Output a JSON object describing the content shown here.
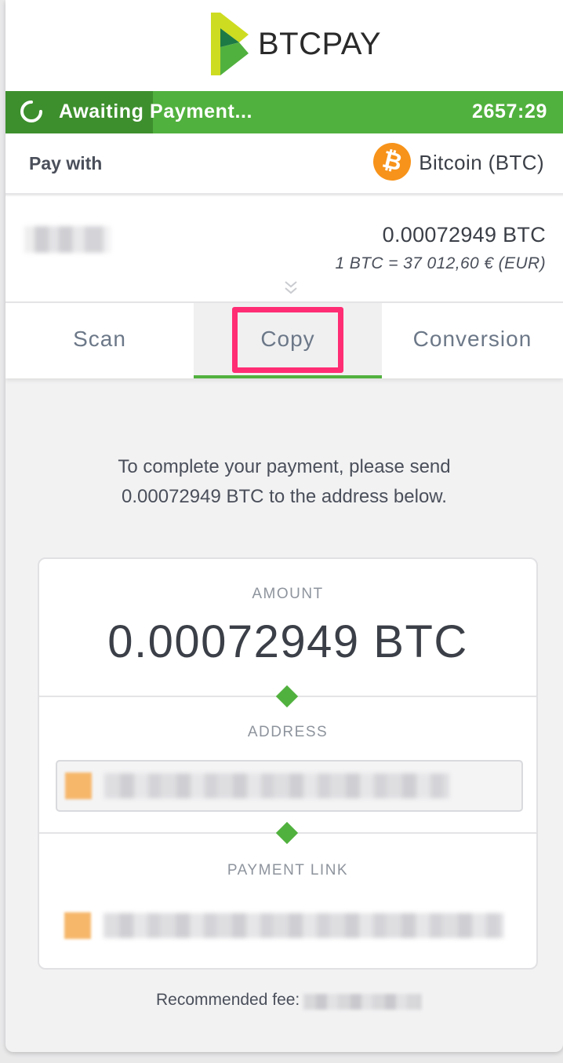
{
  "header": {
    "brand": "BTCPAY",
    "logo_colors": [
      "#cedc21",
      "#51b13e",
      "#1e7a44"
    ]
  },
  "status": {
    "text": "Awaiting Payment...",
    "timer": "2657:29",
    "color": "#51b13e",
    "icon": "spinner-icon"
  },
  "pay_with": {
    "label": "Pay with",
    "currency": "Bitcoin (BTC)",
    "currency_icon": "bitcoin-icon",
    "currency_color": "#f7931a"
  },
  "summary": {
    "amount": "0.00072949 BTC",
    "rate": "1 BTC = 37 012,60 € (EUR)",
    "expand_icon": "chevron-double-down-icon"
  },
  "tabs": [
    {
      "label": "Scan",
      "active": false
    },
    {
      "label": "Copy",
      "active": true
    },
    {
      "label": "Conversion",
      "active": false
    }
  ],
  "instructions": {
    "line1": "To complete your payment, please send",
    "line2": "0.00072949 BTC to the address below."
  },
  "panel": {
    "amount_label": "AMOUNT",
    "amount_value": "0.00072949 BTC",
    "address_label": "ADDRESS",
    "payment_link_label": "PAYMENT LINK"
  },
  "fee": {
    "label": "Recommended fee:"
  },
  "highlight_color": "#ff2d74"
}
